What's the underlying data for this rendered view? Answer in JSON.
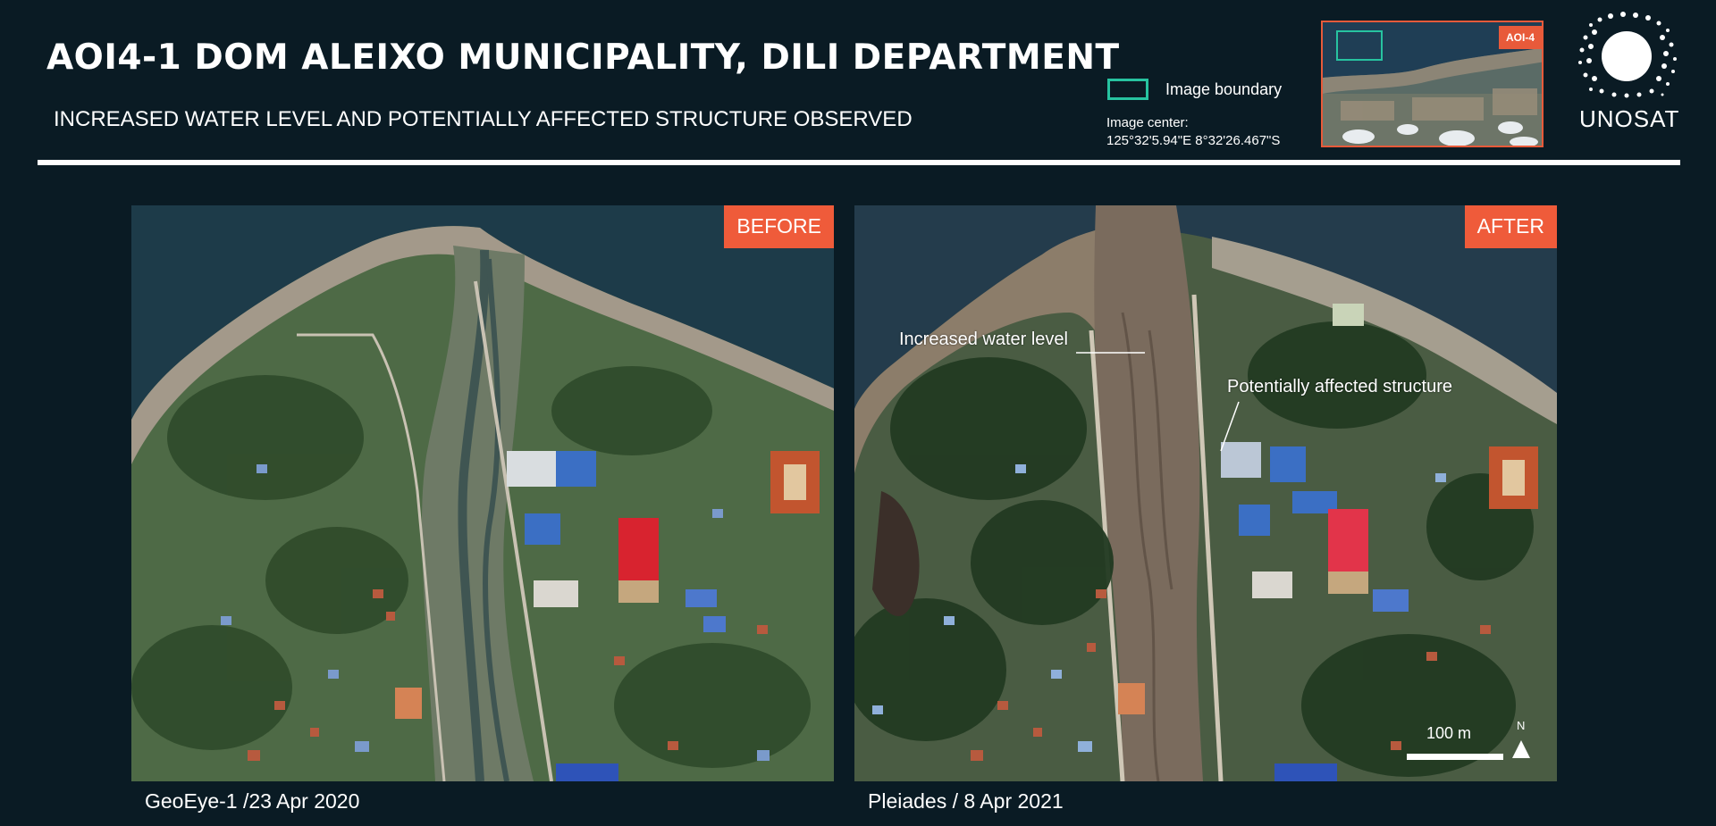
{
  "header": {
    "title": "AOI4-1 DOM ALEIXO MUNICIPALITY, DILI DEPARTMENT",
    "subtitle": "INCREASED WATER LEVEL AND POTENTIALLY AFFECTED STRUCTURE OBSERVED"
  },
  "legend": {
    "boundary_label": "Image boundary",
    "boundary_color": "#27c3a0",
    "center_label": "Image center:",
    "center_coords": "125°32'5.94\"E  8°32'26.467\"S"
  },
  "inset_map": {
    "tag": "AOI-4",
    "tag_color": "#e85a3a"
  },
  "logo": {
    "text": "UNOSAT"
  },
  "panels": {
    "before": {
      "tag": "BEFORE",
      "caption": "GeoEye-1 /23 Apr 2020"
    },
    "after": {
      "tag": "AFTER",
      "caption": "Pleiades / 8 Apr 2021",
      "annotations": {
        "water": "Increased water level",
        "structure": "Potentially affected structure"
      },
      "scale_label": "100 m",
      "north_label": "N"
    }
  },
  "colors": {
    "background": "#0a1b24",
    "accent": "#ef5b3a"
  }
}
